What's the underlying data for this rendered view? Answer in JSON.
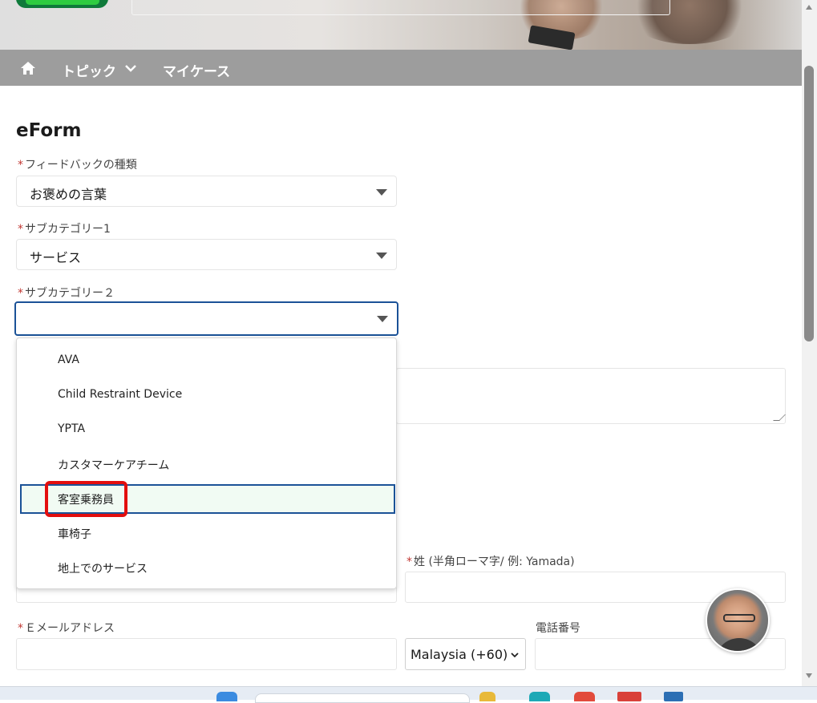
{
  "nav": {
    "topic_label": "トピック",
    "mycase_label": "マイケース"
  },
  "form": {
    "title": "eForm",
    "required_mark": "*",
    "feedback_type": {
      "label": "フィードバックの種類",
      "value": "お褒めの言葉"
    },
    "subcategory1": {
      "label": "サブカテゴリー1",
      "value": "サービス"
    },
    "subcategory2": {
      "label": "サブカテゴリー２",
      "value": "",
      "options": [
        "AVA",
        "Child Restraint Device",
        "YPTA",
        "カスタマーケアチーム",
        "客室乗務員",
        "車椅子",
        "地上でのサービス"
      ],
      "highlighted_option": "客室乗務員"
    },
    "last_name": {
      "label": "姓 (半角ローマ字/ 例: Yamada)"
    },
    "email": {
      "label": "Ｅメールアドレス"
    },
    "phone": {
      "label": "電話番号",
      "country_code": "Malaysia (+60)"
    }
  },
  "colors": {
    "nav_bg": "#9d9d9d",
    "focus_border": "#1b5297",
    "required": "#c23934",
    "highlight_box": "#e30e0e"
  }
}
